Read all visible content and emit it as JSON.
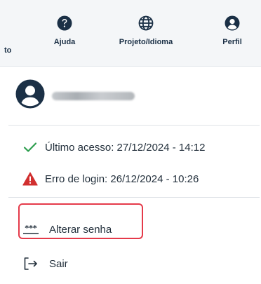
{
  "nav": {
    "truncated_label": "to",
    "items": [
      {
        "label": "Ajuda",
        "icon": "help-icon"
      },
      {
        "label": "Projeto/Idioma",
        "icon": "globe-icon"
      },
      {
        "label": "Perfil",
        "icon": "user-icon"
      }
    ]
  },
  "user": {
    "avatar_icon": "user-avatar-icon"
  },
  "info": {
    "last_access": "Último acesso: 27/12/2024 - 14:12",
    "login_error": "Erro de login: 26/12/2024 - 10:26"
  },
  "actions": {
    "change_password": "Alterar senha",
    "logout": "Sair"
  },
  "colors": {
    "nav_icon": "#1b3046",
    "success": "#2e9e4f",
    "danger": "#d12f2f",
    "highlight": "#e53a4a"
  }
}
